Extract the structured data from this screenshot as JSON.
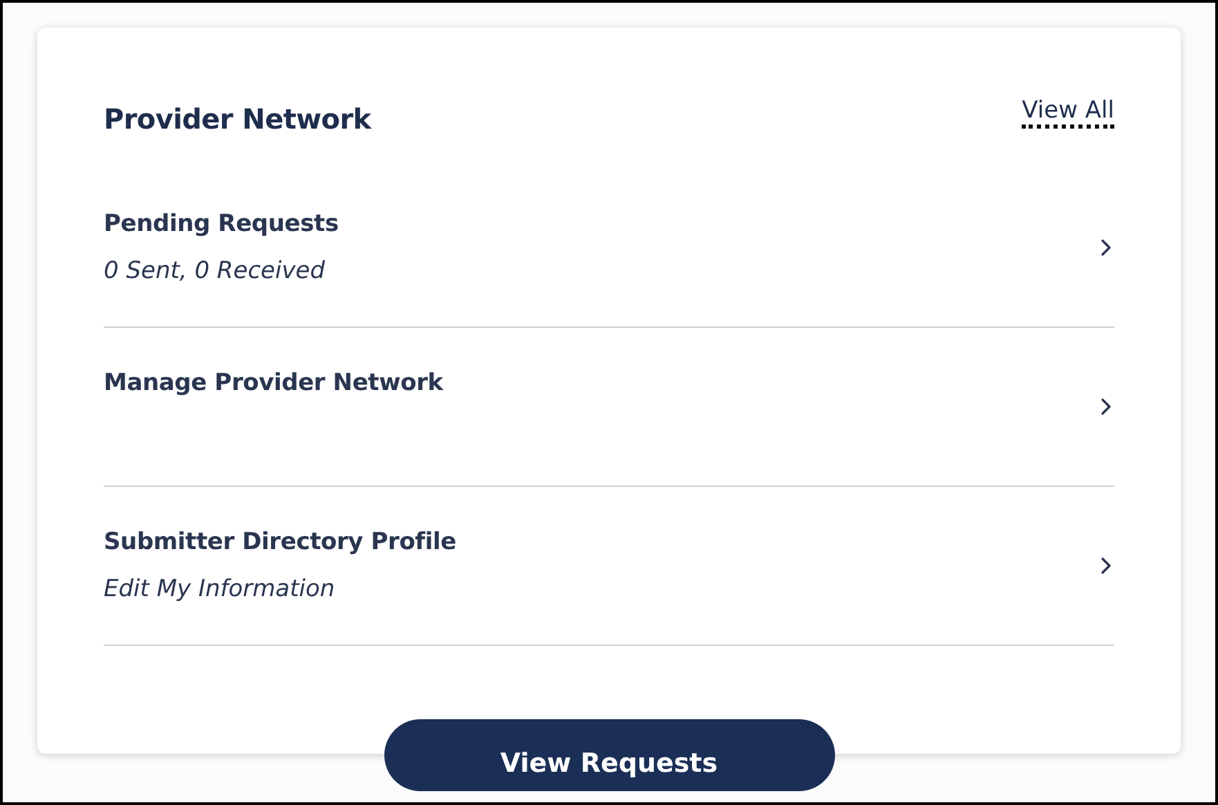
{
  "card": {
    "title": "Provider Network",
    "link": "View All"
  },
  "rows": [
    {
      "title": "Pending Requests",
      "subtitle": "0 Sent, 0 Received"
    },
    {
      "title": "Manage Provider Network"
    },
    {
      "title": "Submitter Directory Profile",
      "subtitle": "Edit My Information"
    }
  ],
  "button": "View Requests"
}
